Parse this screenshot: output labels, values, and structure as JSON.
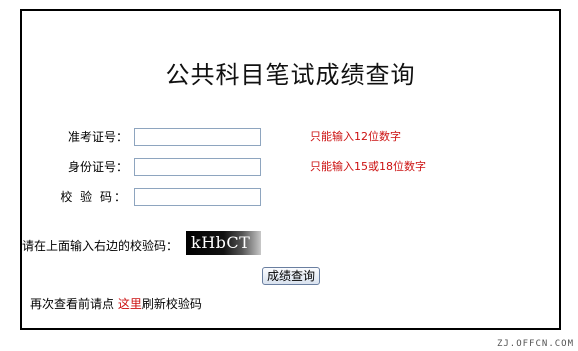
{
  "title": "公共科目笔试成绩查询",
  "form": {
    "fields": [
      {
        "label": "准考证号：",
        "value": "",
        "hint": "只能输入12位数字"
      },
      {
        "label": "身份证号：",
        "value": "",
        "hint": "只能输入15或18位数字"
      },
      {
        "label": "校 验 码：",
        "value": "",
        "hint": ""
      }
    ],
    "captcha_prompt": "请在上面输入右边的校验码：",
    "captcha_text": "kHbCT",
    "submit_label": "成绩查询"
  },
  "refresh": {
    "prefix": "再次查看前请点 ",
    "link": "这里",
    "suffix": "刷新校验码"
  },
  "watermark": "ZJ.OFFCN.COM"
}
